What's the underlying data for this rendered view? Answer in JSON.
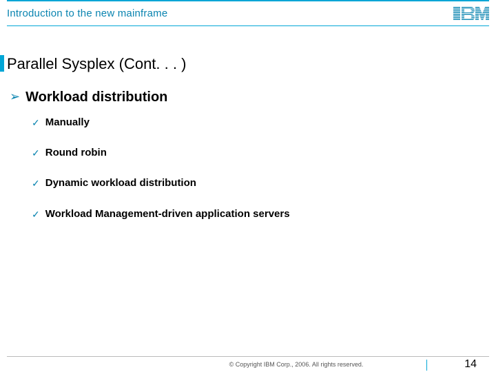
{
  "header": {
    "title": "Introduction to the new mainframe",
    "logo_label": "IBM"
  },
  "heading": "Parallel Sysplex (Cont. . . )",
  "bullets": {
    "level1": "Workload distribution",
    "items": [
      "Manually",
      "Round robin",
      "Dynamic workload distribution",
      "Workload Management-driven application servers"
    ]
  },
  "footer": {
    "copyright": "© Copyright IBM Corp., 2006. All rights reserved.",
    "page_number": "14"
  }
}
